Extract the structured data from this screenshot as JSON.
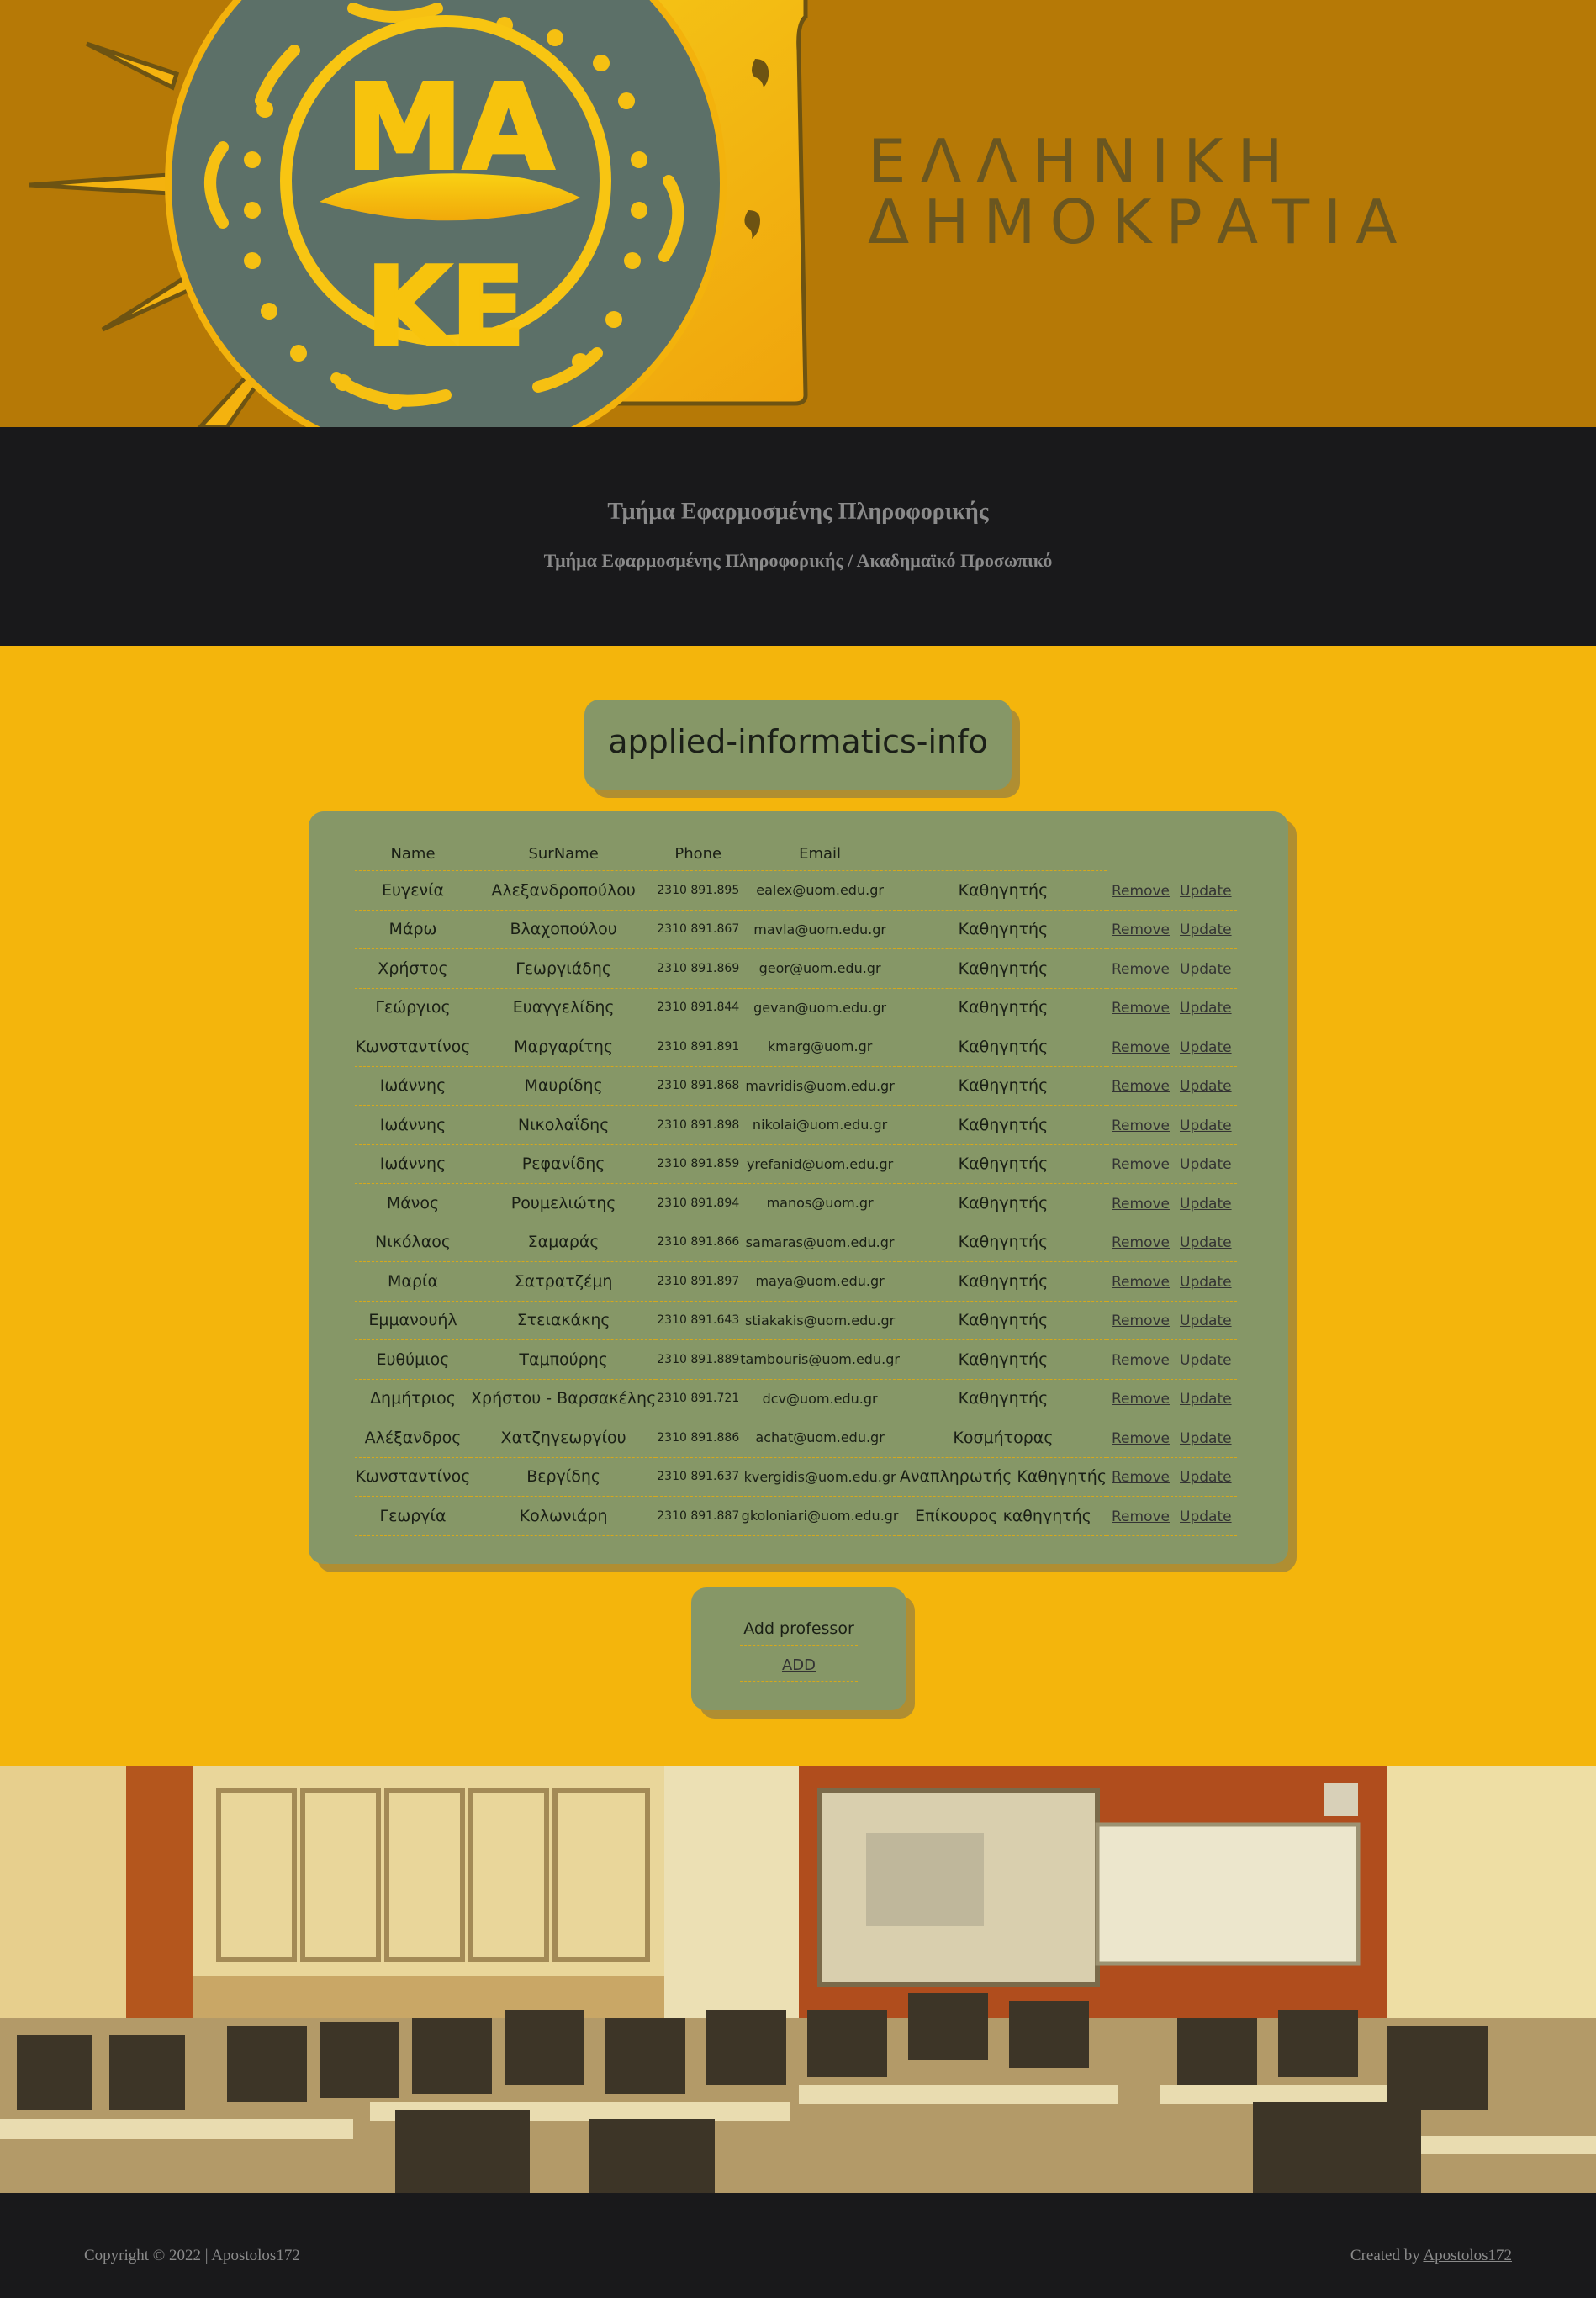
{
  "banner": {
    "logo_text_top": "ΜΑ",
    "logo_text_bottom": "ΚΕ",
    "title_line1": "ΕΛΛΗΝΙΚΗ",
    "title_line2": "ΔΗΜΟΚΡΑΤΙΑ"
  },
  "info": {
    "department": "Τμήμα Εφαρμοσμένης Πληροφορικής",
    "breadcrumb": "Τμήμα Εφαρμοσμένης Πληροφορικής / Ακαδημαϊκό Προσωπικό"
  },
  "heading": "applied-informatics-info",
  "table": {
    "headers": [
      "Name",
      "SurName",
      "Phone",
      "Email"
    ],
    "remove_label": "Remove",
    "update_label": "Update",
    "rows": [
      {
        "name": "Ευγενία",
        "surname": "Αλεξανδροπούλου",
        "phone": "2310 891.895",
        "email": "ealex@uom.edu.gr",
        "role": "Καθηγητής"
      },
      {
        "name": "Μάρω",
        "surname": "Βλαχοπούλου",
        "phone": "2310 891.867",
        "email": "mavla@uom.edu.gr",
        "role": "Καθηγητής"
      },
      {
        "name": "Χρήστος",
        "surname": "Γεωργιάδης",
        "phone": "2310 891.869",
        "email": "geor@uom.edu.gr",
        "role": "Καθηγητής"
      },
      {
        "name": "Γεώργιος",
        "surname": "Ευαγγελίδης",
        "phone": "2310 891.844",
        "email": "gevan@uom.edu.gr",
        "role": "Καθηγητής"
      },
      {
        "name": "Κωνσταντίνος",
        "surname": "Μαργαρίτης",
        "phone": "2310 891.891",
        "email": "kmarg@uom.gr",
        "role": "Καθηγητής"
      },
      {
        "name": "Ιωάννης",
        "surname": "Μαυρίδης",
        "phone": "2310 891.868",
        "email": "mavridis@uom.edu.gr",
        "role": "Καθηγητής"
      },
      {
        "name": "Ιωάννης",
        "surname": "Νικολαΐδης",
        "phone": "2310 891.898",
        "email": "nikolai@uom.edu.gr",
        "role": "Καθηγητής"
      },
      {
        "name": "Ιωάννης",
        "surname": "Ρεφανίδης",
        "phone": "2310 891.859",
        "email": "yrefanid@uom.edu.gr",
        "role": "Καθηγητής"
      },
      {
        "name": "Μάνος",
        "surname": "Ρουμελιώτης",
        "phone": "2310 891.894",
        "email": "manos@uom.gr",
        "role": "Καθηγητής"
      },
      {
        "name": "Νικόλαος",
        "surname": "Σαμαράς",
        "phone": "2310 891.866",
        "email": "samaras@uom.edu.gr",
        "role": "Καθηγητής"
      },
      {
        "name": "Μαρία",
        "surname": "Σατρατζέμη",
        "phone": "2310 891.897",
        "email": "maya@uom.edu.gr",
        "role": "Καθηγητής"
      },
      {
        "name": "Εμμανουήλ",
        "surname": "Στειακάκης",
        "phone": "2310 891.643",
        "email": "stiakakis@uom.edu.gr",
        "role": "Καθηγητής"
      },
      {
        "name": "Ευθύμιος",
        "surname": "Ταμπούρης",
        "phone": "2310 891.889",
        "email": "tambouris@uom.edu.gr",
        "role": "Καθηγητής"
      },
      {
        "name": "Δημήτριος",
        "surname": "Χρήστου - Βαρσακέλης",
        "phone": "2310 891.721",
        "email": "dcv@uom.edu.gr",
        "role": "Καθηγητής"
      },
      {
        "name": "Αλέξανδρος",
        "surname": "Χατζηγεωργίου",
        "phone": "2310 891.886",
        "email": "achat@uom.edu.gr",
        "role": "Κοσμήτορας"
      },
      {
        "name": "Κωνσταντίνος",
        "surname": "Βεργίδης",
        "phone": "2310 891.637",
        "email": "kvergidis@uom.edu.gr",
        "role": "Αναπληρωτής Καθηγητής"
      },
      {
        "name": "Γεωργία",
        "surname": "Κολωνιάρη",
        "phone": "2310 891.887",
        "email": "gkoloniari@uom.edu.gr",
        "role": "Επίκουρος καθηγητής"
      }
    ]
  },
  "add_section": {
    "label": "Add professor",
    "link": "ADD"
  },
  "footer": {
    "copyright": "Copyright © 2022 | Apostolos172",
    "created_by": "Created by",
    "author": "Apostolos172"
  },
  "colors": {
    "page_background": "#f4b50c",
    "banner_background": "#b67906",
    "dark_bar": "#19191b",
    "card_green": "#869767"
  }
}
